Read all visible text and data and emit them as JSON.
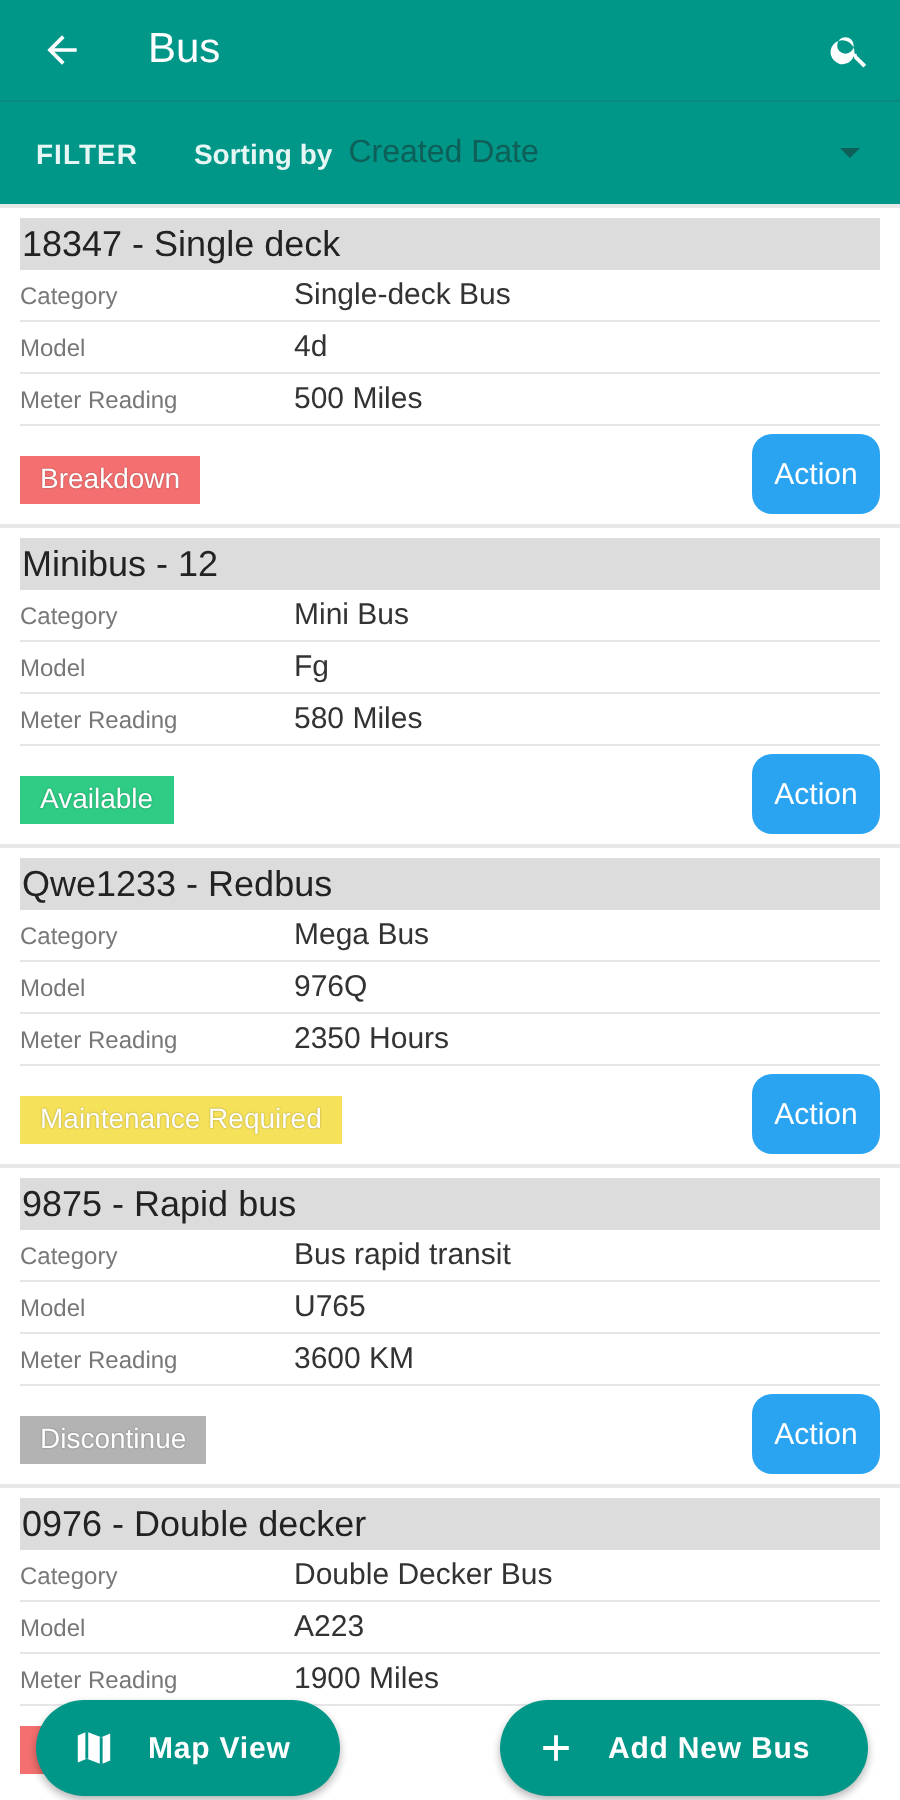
{
  "app_bar": {
    "title": "Bus"
  },
  "filter_bar": {
    "filter": "FILTER",
    "sort_label": "Sorting by",
    "sort_value": "Created Date"
  },
  "buses": [
    {
      "title": "18347 - Single deck",
      "fields": [
        {
          "label": "Category",
          "value": "Single-deck Bus"
        },
        {
          "label": "Model",
          "value": "4d"
        },
        {
          "label": "Meter Reading",
          "value": "500 Miles"
        }
      ],
      "status": {
        "label": "Breakdown",
        "color": "#f47070"
      },
      "action": "Action"
    },
    {
      "title": "Minibus - 12",
      "fields": [
        {
          "label": "Category",
          "value": "Mini Bus"
        },
        {
          "label": "Model",
          "value": "Fg"
        },
        {
          "label": "Meter Reading",
          "value": "580 Miles"
        }
      ],
      "status": {
        "label": "Available",
        "color": "#2ecc85"
      },
      "action": "Action"
    },
    {
      "title": "Qwe1233 - Redbus",
      "fields": [
        {
          "label": "Category",
          "value": "Mega Bus"
        },
        {
          "label": "Model",
          "value": "976Q"
        },
        {
          "label": "Meter Reading",
          "value": "2350 Hours"
        }
      ],
      "status": {
        "label": "Maintenance Required",
        "color": "#f5e15a"
      },
      "action": "Action"
    },
    {
      "title": "9875 - Rapid bus",
      "fields": [
        {
          "label": "Category",
          "value": "Bus rapid transit"
        },
        {
          "label": "Model",
          "value": "U765"
        },
        {
          "label": "Meter Reading",
          "value": "3600 KM"
        }
      ],
      "status": {
        "label": "Discontinue",
        "color": "#b3b3b3"
      },
      "action": "Action"
    },
    {
      "title": "0976 - Double decker",
      "fields": [
        {
          "label": "Category",
          "value": "Double Decker Bus"
        },
        {
          "label": "Model",
          "value": "A223"
        },
        {
          "label": "Meter Reading",
          "value": "1900 Miles"
        }
      ],
      "status": {
        "color": "#f47070"
      }
    }
  ],
  "fabs": [
    {
      "kind": "map",
      "label": "Map View"
    },
    {
      "kind": "add",
      "label": "Add New Bus"
    }
  ]
}
